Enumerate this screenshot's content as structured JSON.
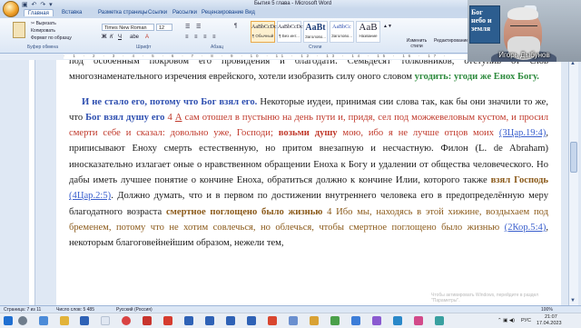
{
  "window": {
    "title": "Бытия 5 глава - Microsoft Word",
    "quick_access": "▣ ↶ ↷ ▾"
  },
  "tabs": [
    "Главная",
    "Вставка",
    "Разметка страницы",
    "Ссылки",
    "Рассылки",
    "Рецензирование",
    "Вид"
  ],
  "ribbon": {
    "clipboard": {
      "cut": "✂ Вырезать",
      "copy": "Копировать",
      "format": "Формат по образцу",
      "label": "Буфер обмена"
    },
    "font": {
      "family": "Times New Roman",
      "size": "12",
      "label": "Шрифт"
    },
    "paragraph_label": "Абзац",
    "styles": [
      {
        "sample": "AaBbCcDc",
        "name": "¶ Обычный"
      },
      {
        "sample": "AaBbCcDc",
        "name": "¶ Без инт..."
      },
      {
        "sample": "AaBt",
        "name": "Заголово..."
      },
      {
        "sample": "AaBbCc",
        "name": "Заголово..."
      },
      {
        "sample": "AaB",
        "name": "Название"
      }
    ],
    "styles_label": "Стили",
    "change_styles": "Изменить стили",
    "editing": "Редактирование"
  },
  "document": {
    "para1": {
      "prefix": "под особенным покровом его провидения и благодати. Семьдесят толковников, отступив от слов многознаменательного изречения еврейского, хотели изобразить силу оного словом ",
      "phrase": "угодить: угоди же Енох Богу."
    },
    "para2": {
      "lead": "И не стало его, потому что Бог взял его.",
      "s1": " Некоторые иудеи, принимая сии слова так, как бы они значили то же, что ",
      "bold1": "Бог взял душу его",
      "ref1_num": " 4 ",
      "ref1_letter": "А",
      "q1": " сам отошел в пустыню на день пути и, придя, сел под можжевеловым кустом, и просил смерти себе и сказал: довольно уже, Господи;",
      "q1_bold": " возьми душу",
      "q1_end": " мою, ибо я не лучше отцов моих",
      "cite1": "(3Цар.19:4)",
      "s2": ", приписывают Еноху смерть естественную, но притом внезапную и несчастную. Филон (L. de Abraham) иносказательно излагает оные о нравственном обращении Еноха к Богу и удалении от общества человеческого. Но дабы иметь лучшее понятие о кончине Еноха, обратиться должно к кончине Илии, которого также ",
      "bold2": "взял Господь",
      "cite2": "(4Цар.2:5)",
      "s3": ". Должно думать, что и в первом по достижении внутреннего человека его в предопределённую меру благодатного возраста ",
      "bold3": "смертное поглощено было жизнью",
      "q2": " 4 Ибо мы, находясь в этой хижине, воздыхаем под бременем, потому что не хотим совлечься, но облечься, чтобы смертное поглощено было жизнью",
      "cite3": "(2Кор.5:4)",
      "s4": ", некоторым благоговейнейшим образом, нежели тем,"
    }
  },
  "statusbar": {
    "page": "Страница: 7 из 11",
    "words": "Число слов: 5 485",
    "lang": "Русский (Россия)",
    "zoom": "100%"
  },
  "taskbar": {
    "lang": "РУС",
    "time": "21:07",
    "date": "17.04.2023"
  },
  "watermark": {
    "line1": "Чтобы активировать Windows, перейдите в раздел",
    "line2": "\"Параметры\"."
  },
  "webcam": {
    "name": "Игорь Дыбунов",
    "book": "Бог небо и земля"
  }
}
